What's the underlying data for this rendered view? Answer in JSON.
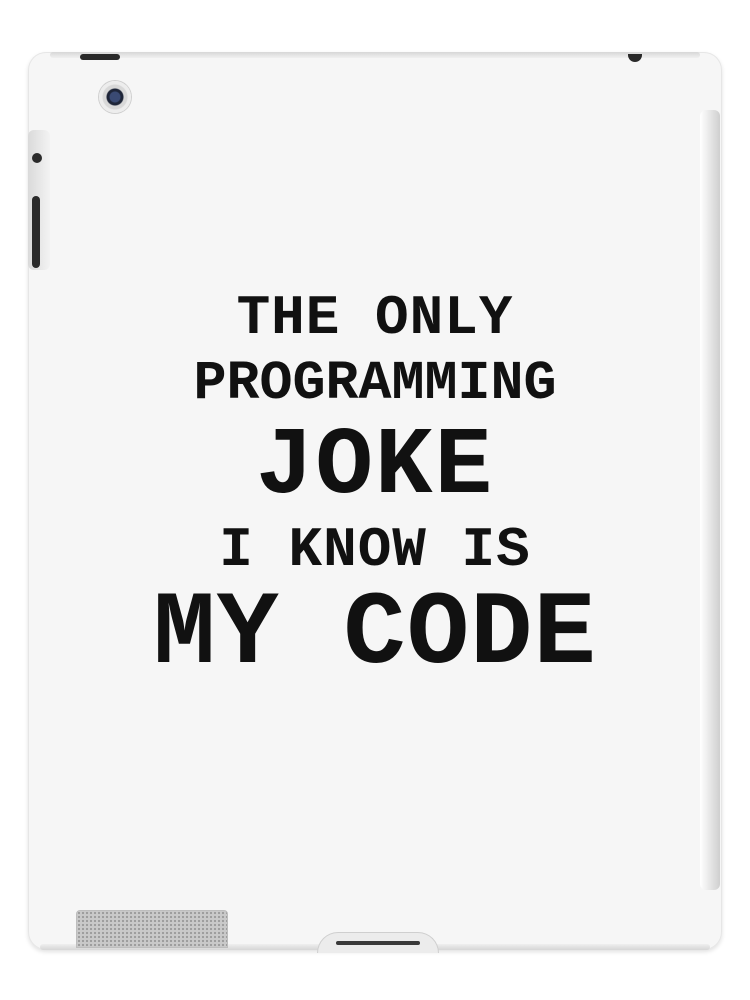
{
  "design": {
    "lines": [
      "THE ONLY",
      "PROGRAMMING",
      "JOKE",
      "I KNOW IS",
      "MY CODE"
    ],
    "text_color": "#111111",
    "case_color": "#f6f6f6"
  },
  "device": {
    "type": "tablet case",
    "icons": [
      "camera-icon",
      "speaker-grille-icon",
      "home-button-icon"
    ]
  }
}
